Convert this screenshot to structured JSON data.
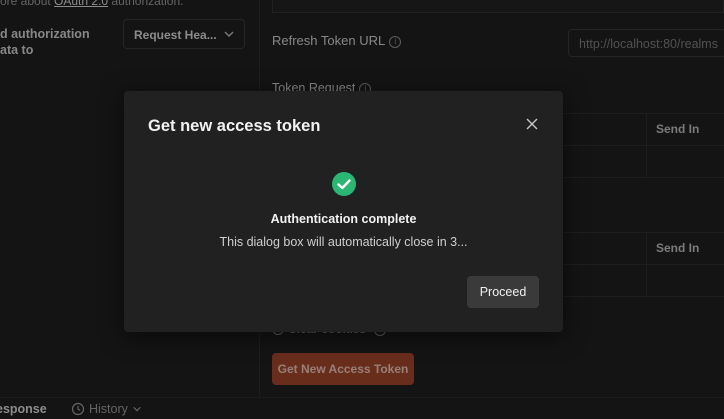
{
  "auth": {
    "intro_prefix": "ore about ",
    "intro_link": "OAuth 2.0",
    "intro_suffix": " authorization.",
    "add_auth_label_line1": "d authorization",
    "add_auth_label_line2": "ata to",
    "add_auth_select_value": "Request Hea..."
  },
  "config": {
    "refresh_token_label": "Refresh Token URL",
    "refresh_token_value": "http://localhost:80/realms",
    "token_request_label": "Token Request",
    "send_in_header_1": "Send In",
    "send_in_header_2": "Send In",
    "clear_cookies_label": "Clear cookies",
    "get_token_button": "Get New Access Token"
  },
  "bottom_bar": {
    "response_tab": "esponse",
    "history_tab": "History"
  },
  "modal": {
    "title": "Get new access token",
    "status_title": "Authentication complete",
    "status_message": "This dialog box will automatically close in 3...",
    "proceed_button": "Proceed"
  },
  "colors": {
    "success": "#2bb673",
    "primary_button": "#a2452b"
  },
  "icons": [
    "chevron-down-icon",
    "info-icon",
    "close-icon",
    "check-circle-icon",
    "history-icon"
  ]
}
